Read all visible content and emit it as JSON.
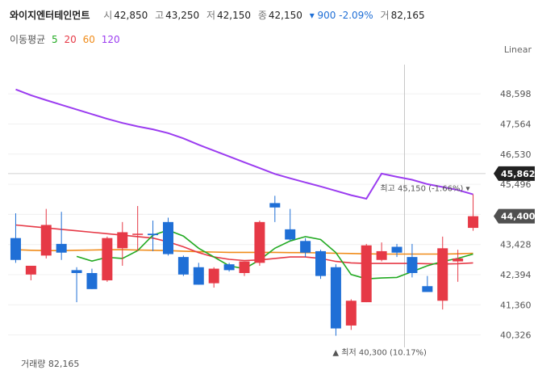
{
  "header": {
    "name": "와이지엔터테인먼트",
    "open_label": "시",
    "open": "42,850",
    "high_label": "고",
    "high": "43,250",
    "low_label": "저",
    "low": "42,150",
    "close_label": "종",
    "close": "42,150",
    "change": "▾ 900 -2.09%",
    "vol_label": "거",
    "volume": "82,165"
  },
  "ma": {
    "label": "이동평균",
    "periods": [
      "5",
      "20",
      "60",
      "120"
    ],
    "colors": [
      "#22aa22",
      "#e63946",
      "#f08c1a",
      "#9b3cf0"
    ]
  },
  "scale_mode": "Linear",
  "volume_label": "거래량 82,165",
  "annotations": {
    "high": "최고 45,150 (-1.66%) ▾",
    "low": "▲ 최저 40,300 (10.17%)"
  },
  "colors": {
    "up": "#e63946",
    "down": "#1f6fd6",
    "tag_dark": "#222222",
    "tag_gray": "#505050"
  },
  "chart_data": {
    "type": "candlestick",
    "yticks": [
      40326,
      41360,
      42394,
      43428,
      44462,
      45496,
      46530,
      47564,
      48598
    ],
    "ytick_labels": [
      "40,326",
      "41,360",
      "42,394",
      "43,428",
      "44,462",
      "45,496",
      "46,530",
      "47,564",
      "48,598"
    ],
    "ylim": [
      39900,
      49600
    ],
    "price_tags": [
      {
        "value": 45862,
        "label": "45,862",
        "style": "dark"
      },
      {
        "value": 44400,
        "label": "44,400",
        "style": "gray"
      }
    ],
    "crosshair_index": 26,
    "candles": [
      {
        "o": 43650,
        "h": 44500,
        "l": 42800,
        "c": 42900
      },
      {
        "o": 42400,
        "h": 42550,
        "l": 42200,
        "c": 42700
      },
      {
        "o": 43050,
        "h": 44650,
        "l": 42950,
        "c": 44100
      },
      {
        "o": 43450,
        "h": 44550,
        "l": 42900,
        "c": 43150
      },
      {
        "o": 42550,
        "h": 42650,
        "l": 41450,
        "c": 42450
      },
      {
        "o": 42450,
        "h": 42600,
        "l": 41900,
        "c": 41900
      },
      {
        "o": 42200,
        "h": 43700,
        "l": 42150,
        "c": 43650
      },
      {
        "o": 43300,
        "h": 44200,
        "l": 42700,
        "c": 43850
      },
      {
        "o": 43800,
        "h": 44750,
        "l": 43200,
        "c": 43800
      },
      {
        "o": 43800,
        "h": 44250,
        "l": 43200,
        "c": 43750
      },
      {
        "o": 44200,
        "h": 44350,
        "l": 43050,
        "c": 43100
      },
      {
        "o": 43000,
        "h": 43050,
        "l": 42350,
        "c": 42400
      },
      {
        "o": 42650,
        "h": 42800,
        "l": 42050,
        "c": 42050
      },
      {
        "o": 42100,
        "h": 42650,
        "l": 41950,
        "c": 42600
      },
      {
        "o": 42750,
        "h": 42800,
        "l": 42500,
        "c": 42550
      },
      {
        "o": 42450,
        "h": 42800,
        "l": 42350,
        "c": 42850
      },
      {
        "o": 42800,
        "h": 44250,
        "l": 42700,
        "c": 44200
      },
      {
        "o": 44850,
        "h": 45100,
        "l": 44200,
        "c": 44700
      },
      {
        "o": 43950,
        "h": 44650,
        "l": 43550,
        "c": 43600
      },
      {
        "o": 43550,
        "h": 43650,
        "l": 43000,
        "c": 43150
      },
      {
        "o": 43200,
        "h": 43250,
        "l": 42250,
        "c": 42350
      },
      {
        "o": 42650,
        "h": 42750,
        "l": 40300,
        "c": 40550
      },
      {
        "o": 40650,
        "h": 41550,
        "l": 40500,
        "c": 41500
      },
      {
        "o": 41450,
        "h": 43450,
        "l": 41450,
        "c": 43400
      },
      {
        "o": 42900,
        "h": 43500,
        "l": 42850,
        "c": 43200
      },
      {
        "o": 43350,
        "h": 43450,
        "l": 43000,
        "c": 43150
      },
      {
        "o": 43000,
        "h": 43450,
        "l": 42300,
        "c": 42450
      },
      {
        "o": 42000,
        "h": 42350,
        "l": 41900,
        "c": 41800
      },
      {
        "o": 41500,
        "h": 43700,
        "l": 41200,
        "c": 43300
      },
      {
        "o": 42850,
        "h": 43250,
        "l": 42150,
        "c": 42950
      },
      {
        "o": 44000,
        "h": 45150,
        "l": 43900,
        "c": 44400
      }
    ],
    "ma5": [
      null,
      null,
      null,
      null,
      43020,
      42860,
      42990,
      42950,
      43220,
      43750,
      43920,
      43720,
      43300,
      43000,
      42700,
      42600,
      42900,
      43300,
      43550,
      43700,
      43600,
      43150,
      42400,
      42250,
      42280,
      42300,
      42500,
      42700,
      42850,
      42950,
      43100
    ],
    "ma20": [
      44100,
      44050,
      44000,
      43950,
      43900,
      43850,
      43800,
      43750,
      43700,
      43650,
      43520,
      43350,
      43150,
      43000,
      42920,
      42880,
      42900,
      42950,
      43000,
      43000,
      42950,
      42850,
      42800,
      42780,
      42780,
      42780,
      42780,
      42770,
      42760,
      42770,
      42800
    ],
    "ma60": [
      43250,
      43230,
      43220,
      43220,
      43230,
      43240,
      43250,
      43250,
      43240,
      43230,
      43220,
      43200,
      43180,
      43170,
      43160,
      43160,
      43160,
      43160,
      43150,
      43150,
      43140,
      43130,
      43120,
      43110,
      43100,
      43100,
      43100,
      43100,
      43100,
      43110,
      43130
    ],
    "ma120": [
      48750,
      48550,
      48380,
      48220,
      48060,
      47900,
      47740,
      47600,
      47480,
      47380,
      47250,
      47070,
      46850,
      46650,
      46450,
      46250,
      46050,
      45850,
      45700,
      45560,
      45420,
      45270,
      45120,
      45000,
      45860,
      45750,
      45650,
      45500,
      45400,
      45300,
      45150
    ]
  }
}
